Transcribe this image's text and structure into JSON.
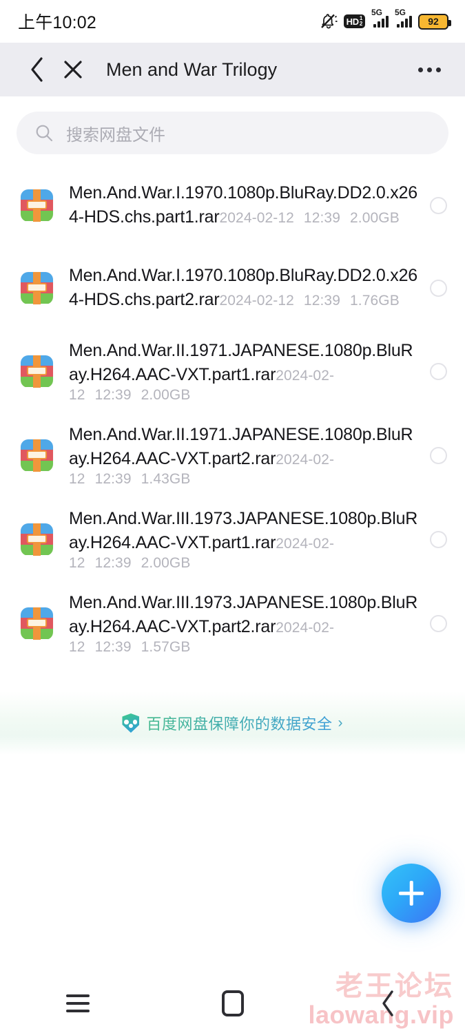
{
  "status_bar": {
    "time": "上午10:02",
    "mute_icon": "bell-muted-icon",
    "hd_label": "HD",
    "hd_sub_top": "1",
    "hd_sub_bottom": "2",
    "network_1": "5G",
    "network_2": "5G",
    "battery_percent": "92"
  },
  "appbar": {
    "back_icon": "chevron-left-icon",
    "close_icon": "close-icon",
    "title": "Men and War Trilogy",
    "more_icon": "more-horizontal-icon"
  },
  "search": {
    "icon": "search-icon",
    "placeholder": "搜索网盘文件",
    "value": ""
  },
  "files": [
    {
      "name": "Men.And.War.I.1970.1080p.BluRay.DD2.0.x264-HDS.chs.part1.rar",
      "date": "2024-02-12",
      "time": "12:39",
      "size": "2.00GB",
      "icon": "rar-archive-icon",
      "selected": false
    },
    {
      "name": "Men.And.War.I.1970.1080p.BluRay.DD2.0.x264-HDS.chs.part2.rar",
      "date": "2024-02-12",
      "time": "12:39",
      "size": "1.76GB",
      "icon": "rar-archive-icon",
      "selected": false
    },
    {
      "name": "Men.And.War.II.1971.JAPANESE.1080p.BluRay.H264.AAC-VXT.part1.rar",
      "date": "2024-02-12",
      "time": "12:39",
      "size": "2.00GB",
      "icon": "rar-archive-icon",
      "selected": false
    },
    {
      "name": "Men.And.War.II.1971.JAPANESE.1080p.BluRay.H264.AAC-VXT.part2.rar",
      "date": "2024-02-12",
      "time": "12:39",
      "size": "1.43GB",
      "icon": "rar-archive-icon",
      "selected": false
    },
    {
      "name": "Men.And.War.III.1973.JAPANESE.1080p.BluRay.H264.AAC-VXT.part1.rar",
      "date": "2024-02-12",
      "time": "12:39",
      "size": "2.00GB",
      "icon": "rar-archive-icon",
      "selected": false
    },
    {
      "name": "Men.And.War.III.1973.JAPANESE.1080p.BluRay.H264.AAC-VXT.part2.rar",
      "date": "2024-02-12",
      "time": "12:39",
      "size": "1.57GB",
      "icon": "rar-archive-icon",
      "selected": false
    }
  ],
  "banner": {
    "icon": "shield-icon",
    "text": "百度网盘保障你的数据安全",
    "arrow": "›"
  },
  "fab": {
    "icon": "plus-icon",
    "label": "+"
  },
  "watermark": {
    "line1": "老王论坛",
    "line2": "laowang.vip"
  },
  "navbar": {
    "recents_icon": "menu-lines-icon",
    "home_icon": "home-square-icon",
    "back_icon": "chevron-left-icon"
  },
  "colors": {
    "appbar_bg": "#ECECF1",
    "search_bg": "#F3F3F6",
    "accent_blue": "#2DA8F8",
    "battery": "#F7B731",
    "banner_green": "#45B98F",
    "watermark_pink": "#F8CBCC"
  }
}
